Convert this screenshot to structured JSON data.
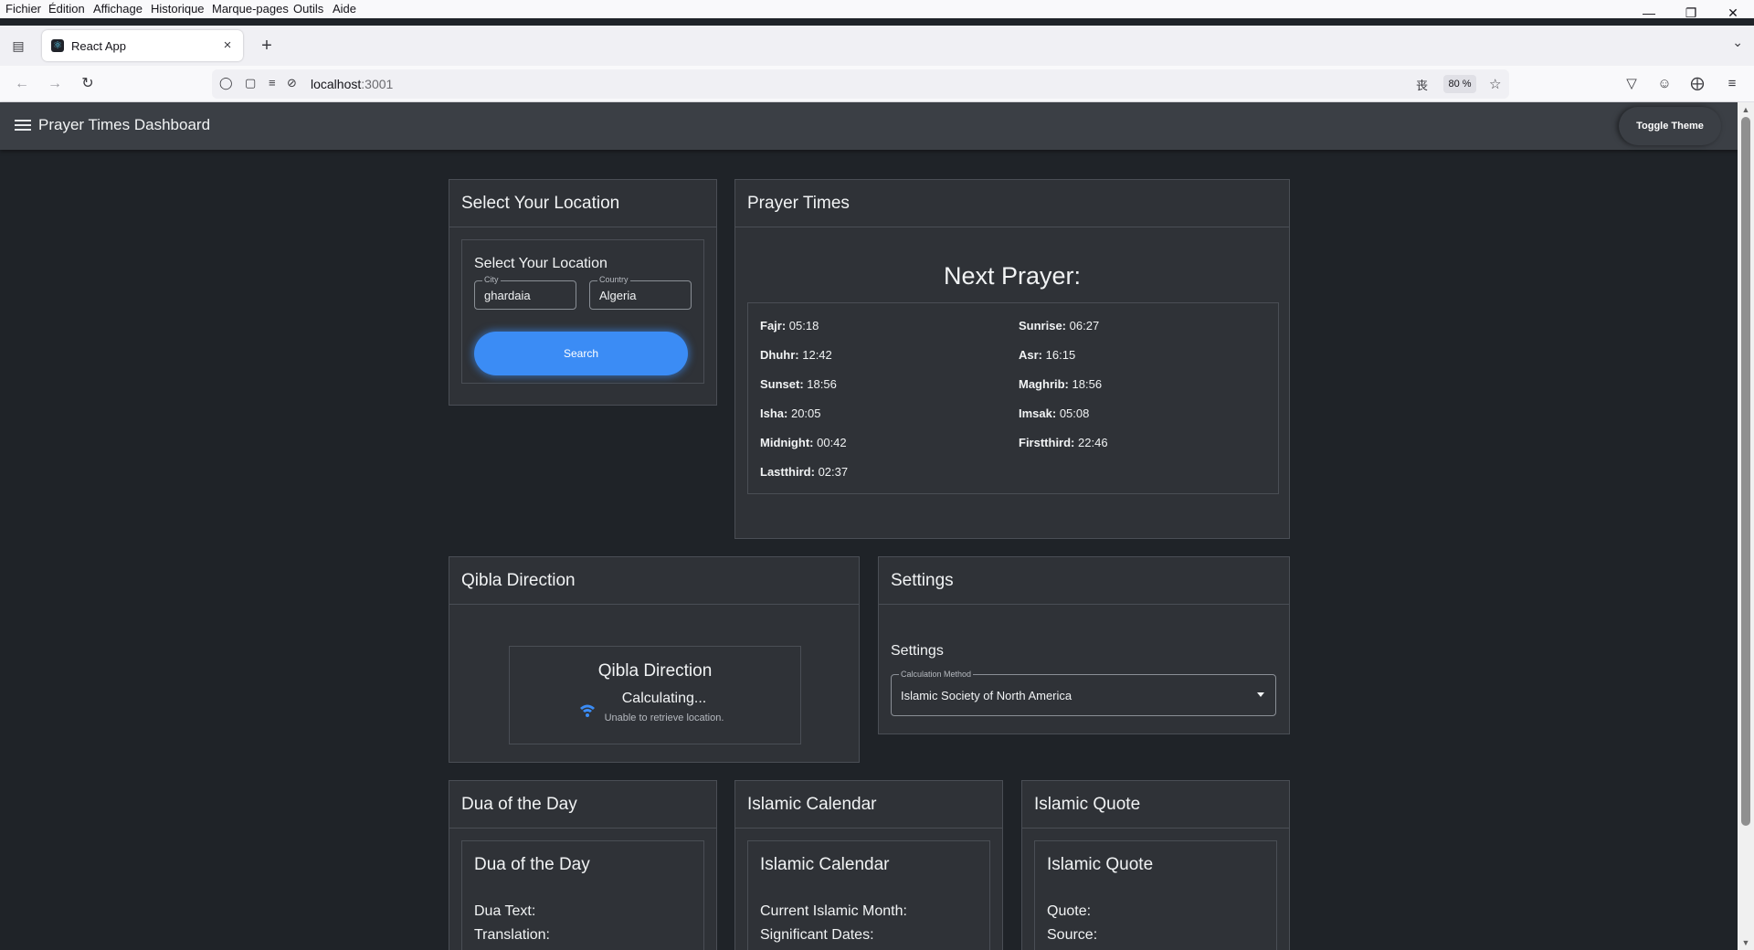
{
  "browser": {
    "menu": [
      "Fichier",
      "Édition",
      "Affichage",
      "Historique",
      "Marque-pages",
      "Outils",
      "Aide"
    ],
    "tab": {
      "title": "React App"
    },
    "url": {
      "host": "localhost",
      "port": ":3001"
    },
    "zoom": "80 %"
  },
  "app": {
    "title": "Prayer Times Dashboard",
    "toggle_theme": "Toggle Theme"
  },
  "location": {
    "card_title": "Select Your Location",
    "form_title": "Select Your Location",
    "city_label": "City",
    "city_value": "ghardaia",
    "country_label": "Country",
    "country_value": "Algeria",
    "search_label": "Search"
  },
  "prayer": {
    "card_title": "Prayer Times",
    "next_prayer": "Next Prayer:",
    "times": [
      {
        "name": "Fajr:",
        "time": "05:18"
      },
      {
        "name": "Sunrise:",
        "time": "06:27"
      },
      {
        "name": "Dhuhr:",
        "time": "12:42"
      },
      {
        "name": "Asr:",
        "time": "16:15"
      },
      {
        "name": "Sunset:",
        "time": "18:56"
      },
      {
        "name": "Maghrib:",
        "time": "18:56"
      },
      {
        "name": "Isha:",
        "time": "20:05"
      },
      {
        "name": "Imsak:",
        "time": "05:08"
      },
      {
        "name": "Midnight:",
        "time": "00:42"
      },
      {
        "name": "Firstthird:",
        "time": "22:46"
      },
      {
        "name": "Lastthird:",
        "time": "02:37"
      }
    ]
  },
  "qibla": {
    "card_title": "Qibla Direction",
    "inner_title": "Qibla Direction",
    "status": "Calculating...",
    "error": "Unable to retrieve location."
  },
  "settings": {
    "card_title": "Settings",
    "section_title": "Settings",
    "method_label": "Calculation Method",
    "method_value": "Islamic Society of North America"
  },
  "dua": {
    "card_title": "Dua of the Day",
    "inner_title": "Dua of the Day",
    "text_label": "Dua Text:",
    "translation_label": "Translation:"
  },
  "calendar": {
    "card_title": "Islamic Calendar",
    "inner_title": "Islamic Calendar",
    "month_label": "Current Islamic Month:",
    "dates_label": "Significant Dates:"
  },
  "quote": {
    "card_title": "Islamic Quote",
    "inner_title": "Islamic Quote",
    "quote_label": "Quote:",
    "source_label": "Source:"
  },
  "colors": {
    "accent": "#3b8cf5",
    "background": "#1f2328",
    "card": "#2f3237",
    "appbar": "#3b3f45"
  }
}
